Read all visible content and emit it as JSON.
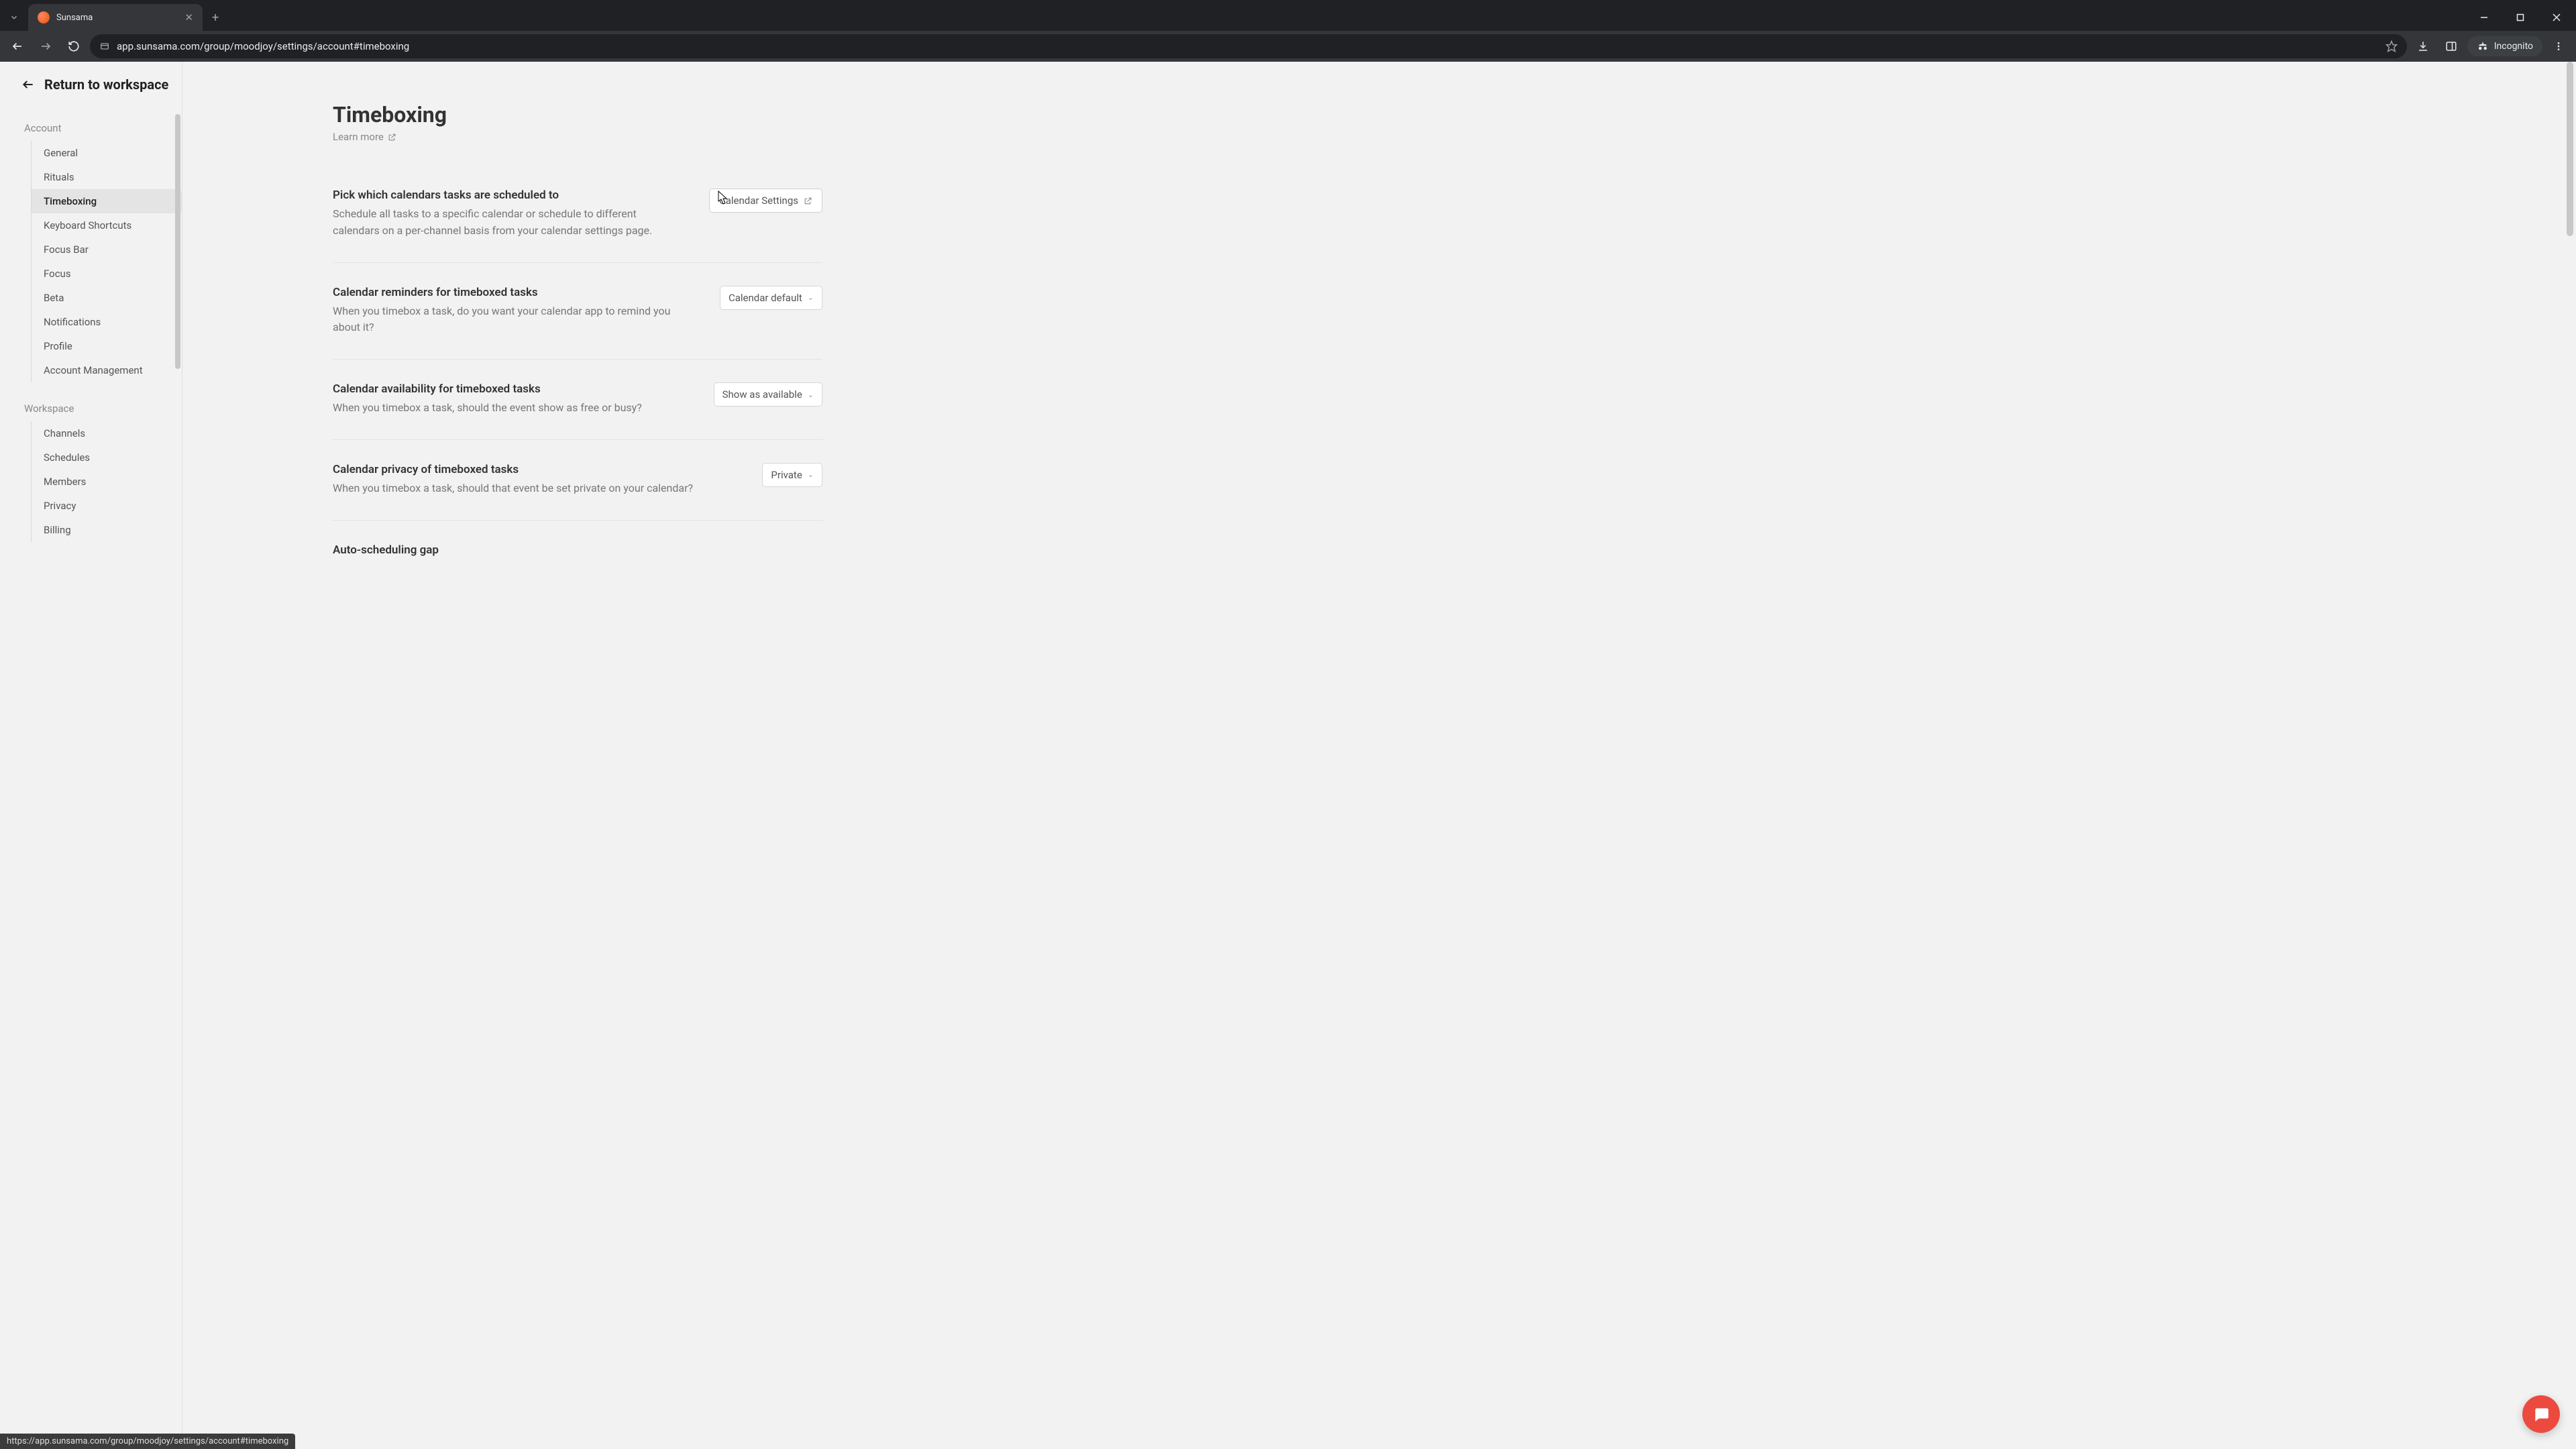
{
  "browser": {
    "tab_title": "Sunsama",
    "url_display": "app.sunsama.com/group/moodjoy/settings/account#timeboxing",
    "incognito_label": "Incognito"
  },
  "header": {
    "return_label": "Return to workspace"
  },
  "sidebar": {
    "groups": [
      {
        "title": "Account",
        "items": [
          "General",
          "Rituals",
          "Timeboxing",
          "Keyboard Shortcuts",
          "Focus Bar",
          "Focus",
          "Beta",
          "Notifications",
          "Profile",
          "Account Management"
        ],
        "active_index": 2
      },
      {
        "title": "Workspace",
        "items": [
          "Channels",
          "Schedules",
          "Members",
          "Privacy",
          "Billing"
        ]
      }
    ]
  },
  "page": {
    "title": "Timeboxing",
    "learn_more": "Learn more"
  },
  "settings": [
    {
      "title": "Pick which calendars tasks are scheduled to",
      "desc": "Schedule all tasks to a specific calendar or schedule to different calendars on a per-channel basis from your calendar settings page.",
      "control_type": "link",
      "control_label": "Calendar Settings"
    },
    {
      "title": "Calendar reminders for timeboxed tasks",
      "desc": "When you timebox a task, do you want your calendar app to remind you about it?",
      "control_type": "dropdown",
      "control_label": "Calendar default"
    },
    {
      "title": "Calendar availability for timeboxed tasks",
      "desc": "When you timebox a task, should the event show as free or busy?",
      "control_type": "dropdown",
      "control_label": "Show as available"
    },
    {
      "title": "Calendar privacy of timeboxed tasks",
      "desc": "When you timebox a task, should that event be set private on your calendar?",
      "control_type": "dropdown",
      "control_label": "Private"
    },
    {
      "title": "Auto-scheduling gap",
      "desc": "",
      "control_type": "none",
      "control_label": ""
    }
  ],
  "status_url": "https://app.sunsama.com/group/moodjoy/settings/account#timeboxing"
}
